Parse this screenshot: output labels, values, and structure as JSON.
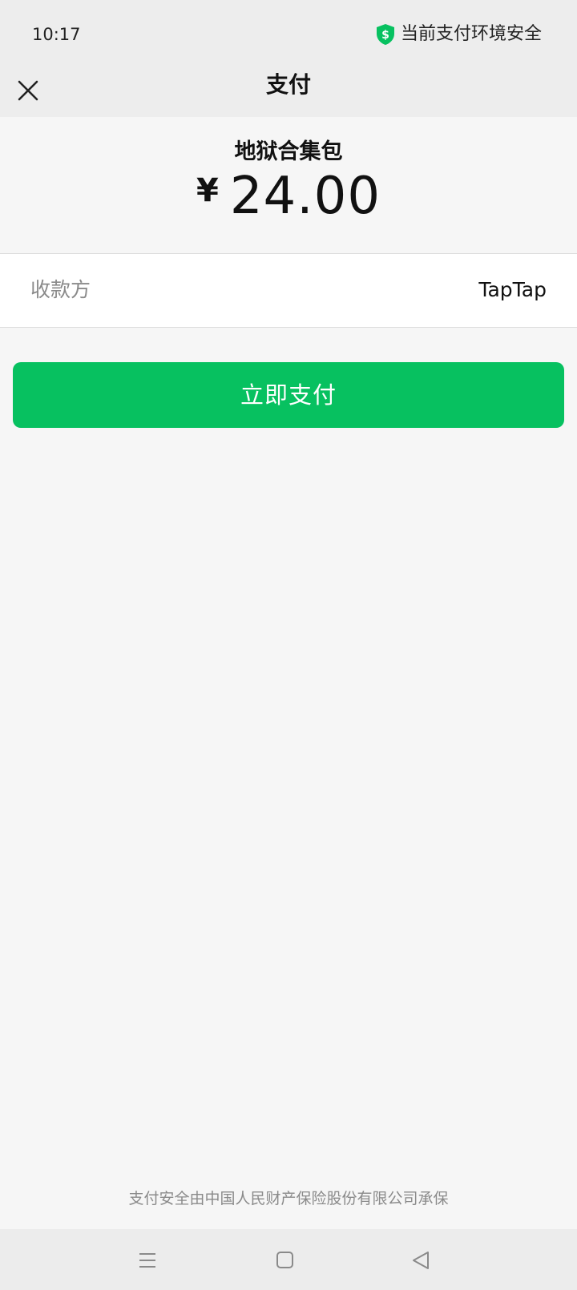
{
  "status_bar": {
    "time": "10:17",
    "secure_text": "当前支付环境安全",
    "secure_icon": "shield-dollar-icon",
    "secure_icon_color": "#07c160"
  },
  "nav": {
    "title": "支付",
    "close_icon": "close-icon"
  },
  "order": {
    "product_name": "地狱合集包",
    "currency_symbol": "¥",
    "amount": "24.00"
  },
  "payee": {
    "label": "收款方",
    "value": "TapTap"
  },
  "actions": {
    "pay_label": "立即支付",
    "pay_color": "#07c160"
  },
  "footer": {
    "insurance_note": "支付安全由中国人民财产保险股份有限公司承保"
  },
  "system_nav": {
    "menu_icon": "menu-icon",
    "home_icon": "home-icon",
    "back_icon": "back-icon"
  }
}
